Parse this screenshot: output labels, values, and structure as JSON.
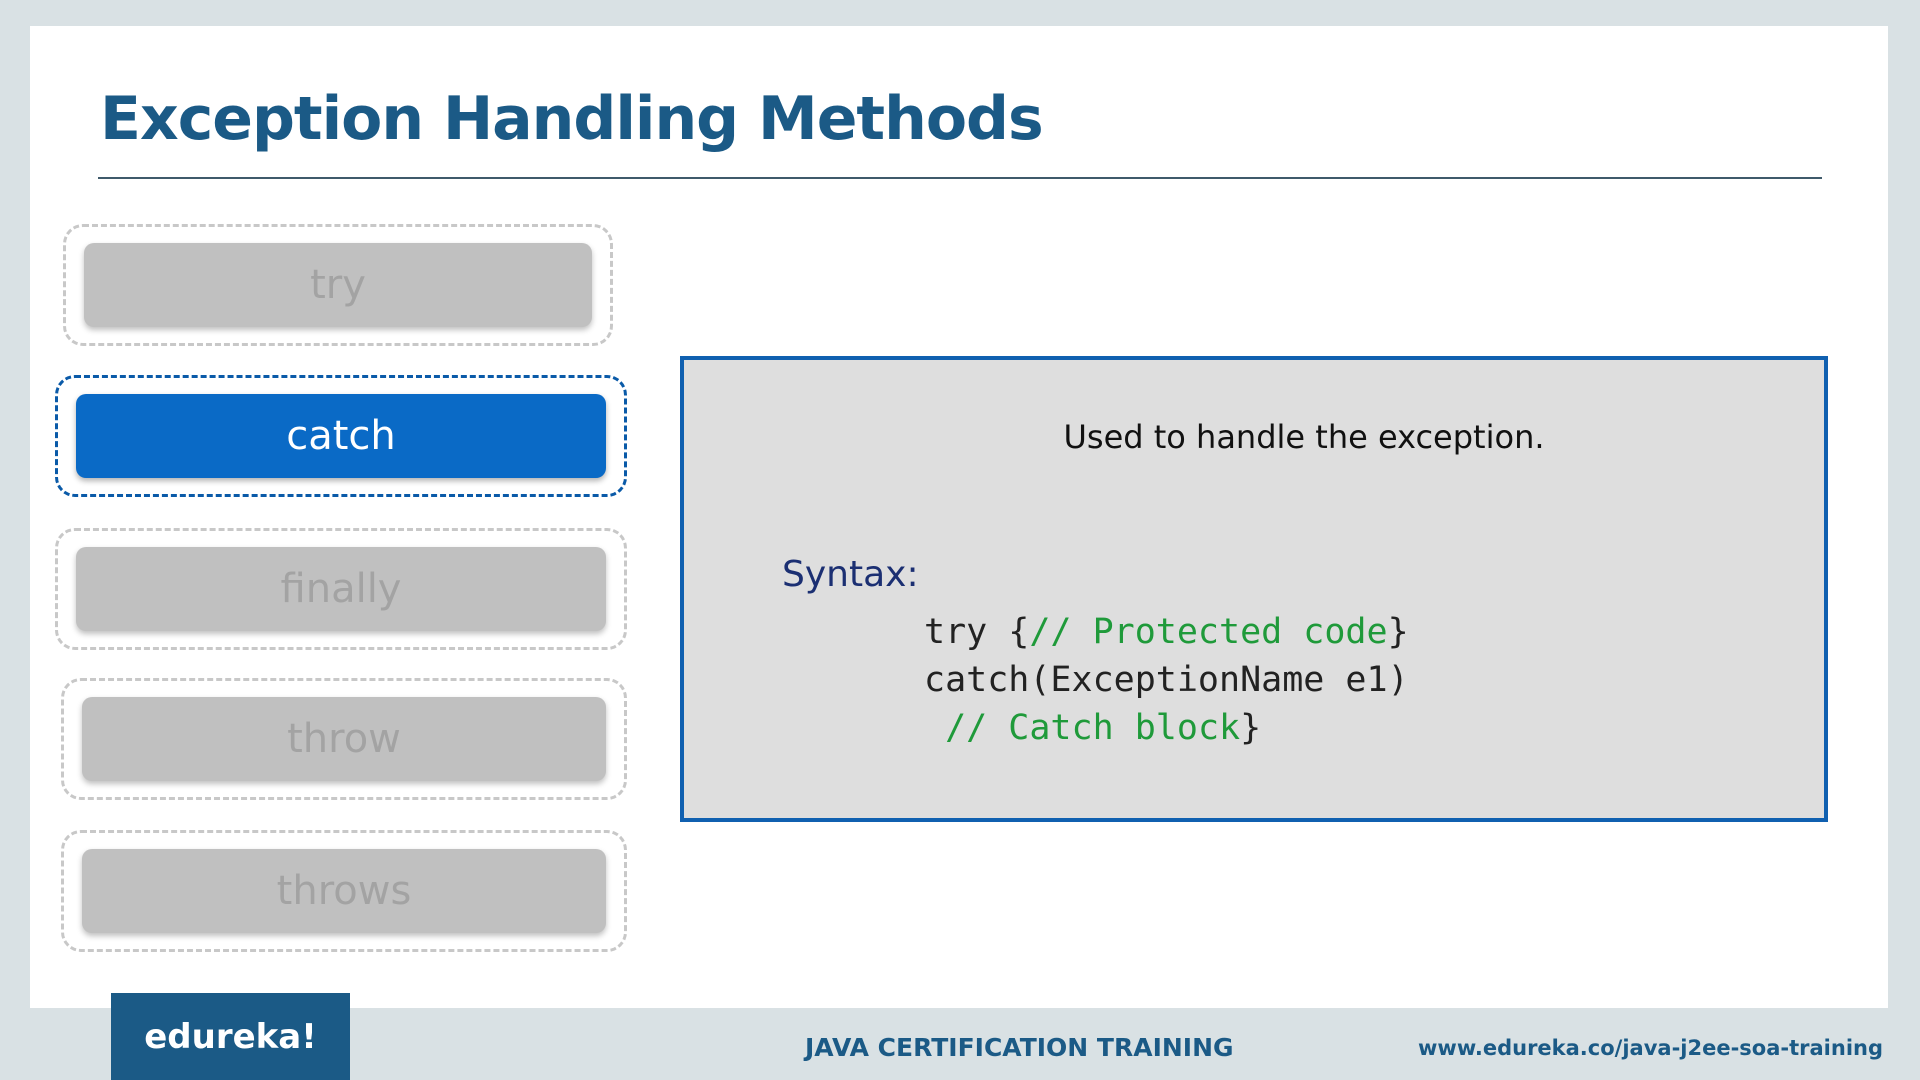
{
  "slide": {
    "title": "Exception Handling Methods"
  },
  "methods": [
    {
      "label": "try",
      "active": false
    },
    {
      "label": "catch",
      "active": true
    },
    {
      "label": "finally",
      "active": false
    },
    {
      "label": "throw",
      "active": false
    },
    {
      "label": "throws",
      "active": false
    }
  ],
  "info": {
    "description": "Used to handle the exception.",
    "syntax_label": "Syntax:",
    "code": {
      "line1_code": "try {",
      "line1_comment": "// Protected code",
      "line1_end": "}",
      "line2_code": "catch(ExceptionName e1)",
      "line3_lead": " ",
      "line3_comment": "// Catch block",
      "line3_end": "}"
    }
  },
  "footer": {
    "logo": "edureka!",
    "course": "JAVA CERTIFICATION TRAINING",
    "url": "www.edureka.co/java-j2ee-soa-training"
  },
  "colors": {
    "title": "#1b5a86",
    "active_pill": "#0a6ac6",
    "inactive_pill": "#c0c0c0",
    "comment": "#1f9a3a",
    "box_border": "#1060b0"
  }
}
